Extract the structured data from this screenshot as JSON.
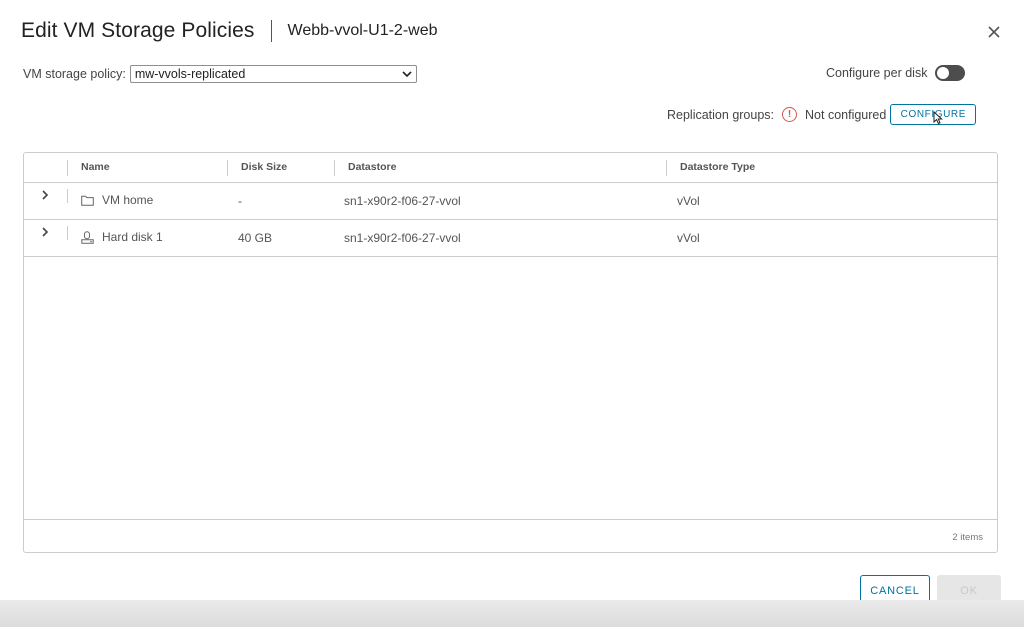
{
  "dialog": {
    "title": "Edit VM Storage Policies",
    "subtitle": "Webb-vvol-U1-2-web",
    "close_icon": "close-icon"
  },
  "policy": {
    "label": "VM storage policy:",
    "selected": "mw-vvols-replicated"
  },
  "per_disk": {
    "label": "Configure per disk",
    "enabled": false
  },
  "replication": {
    "label": "Replication groups:",
    "status": "Not configured",
    "status_color": "#d9534f",
    "configure_label": "CONFIGURE"
  },
  "grid": {
    "columns": [
      "Name",
      "Disk Size",
      "Datastore",
      "Datastore Type"
    ],
    "rows": [
      {
        "icon": "folder-icon",
        "name": "VM home",
        "disk_size": "-",
        "datastore": "sn1-x90r2-f06-27-vvol",
        "type": "vVol"
      },
      {
        "icon": "hard-disk-icon",
        "name": "Hard disk 1",
        "disk_size": "40 GB",
        "datastore": "sn1-x90r2-f06-27-vvol",
        "type": "vVol"
      }
    ],
    "footer": "2 items"
  },
  "actions": {
    "cancel_label": "CANCEL",
    "ok_label": "OK",
    "accent_color": "#0072a3"
  }
}
